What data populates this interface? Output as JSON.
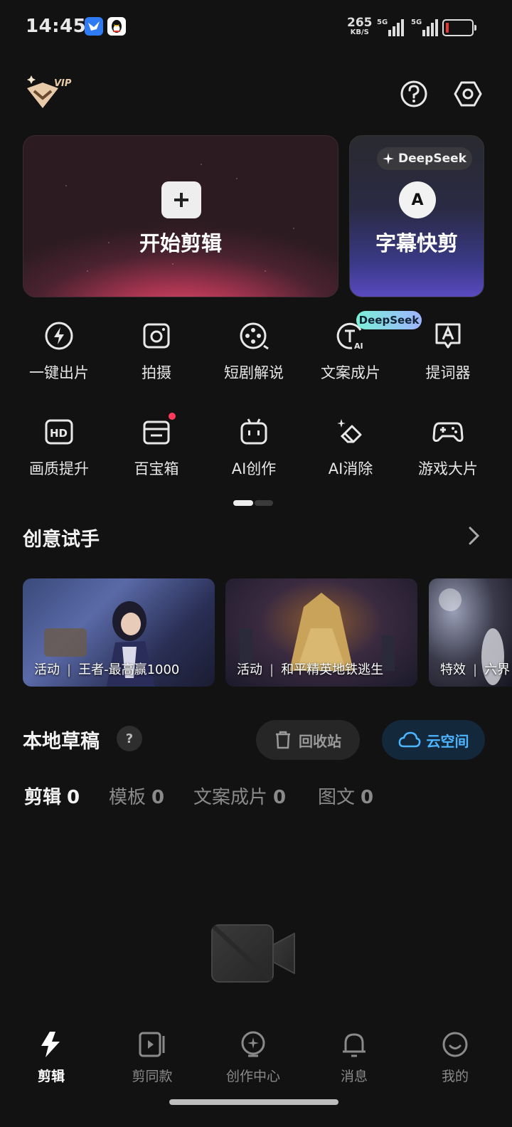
{
  "status": {
    "time": "14:45",
    "net_speed_value": "265",
    "net_speed_unit": "KB/S",
    "signal_1": "5G",
    "signal_2": "5G",
    "battery_level": 0.1,
    "icons": [
      "bird-app-icon",
      "qq-penguin-icon"
    ]
  },
  "header": {
    "vip_badge": "VIP",
    "icons": [
      "help-circle-icon",
      "settings-hexagon-icon"
    ]
  },
  "hero": {
    "main_label": "开始剪辑",
    "sub_label": "字幕快剪",
    "sub_pill": "DeepSeek",
    "sub_letter": "A",
    "accent": "#f0506f"
  },
  "tools": {
    "row1": [
      {
        "label": "一键出片",
        "icon": "lightning-circle-icon"
      },
      {
        "label": "拍摄",
        "icon": "camera-icon"
      },
      {
        "label": "短剧解说",
        "icon": "film-reel-icon"
      },
      {
        "label": "文案成片",
        "icon": "text-ai-icon"
      },
      {
        "label": "提词器",
        "icon": "teleprompter-icon"
      }
    ],
    "row2": [
      {
        "label": "画质提升",
        "icon": "hd-icon"
      },
      {
        "label": "百宝箱",
        "icon": "toolbox-icon"
      },
      {
        "label": "AI创作",
        "icon": "ai-robot-icon"
      },
      {
        "label": "AI消除",
        "icon": "eraser-sparkle-icon"
      },
      {
        "label": "游戏大片",
        "icon": "gamepad-icon"
      }
    ],
    "badge": "DeepSeek"
  },
  "creative": {
    "title": "创意试手",
    "cards": [
      {
        "tag": "活动",
        "title": "王者-最高赢1000"
      },
      {
        "tag": "活动",
        "title": "和平精英地铁逃生"
      },
      {
        "tag": "特效",
        "title": "六界"
      }
    ]
  },
  "drafts": {
    "title": "本地草稿",
    "help": "?",
    "recycle_label": "回收站",
    "cloud_label": "云空间",
    "tabs": [
      {
        "label": "剪辑",
        "count": "0"
      },
      {
        "label": "模板",
        "count": "0"
      },
      {
        "label": "文案成片",
        "count": "0"
      },
      {
        "label": "图文",
        "count": "0"
      }
    ]
  },
  "nav": [
    {
      "label": "剪辑",
      "icon": "lightning-icon"
    },
    {
      "label": "剪同款",
      "icon": "template-video-icon"
    },
    {
      "label": "创作中心",
      "icon": "bulb-sparkle-icon"
    },
    {
      "label": "消息",
      "icon": "bell-icon"
    },
    {
      "label": "我的",
      "icon": "smile-face-icon"
    }
  ]
}
